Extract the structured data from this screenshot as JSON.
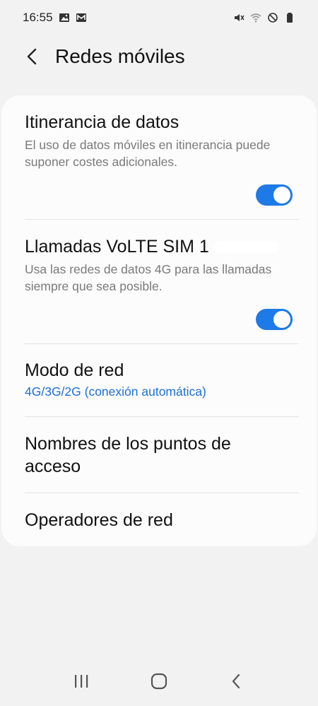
{
  "status_bar": {
    "time": "16:55",
    "icons_left": [
      "gallery-icon",
      "mail-icon"
    ],
    "icons_right": [
      "mute-icon",
      "wifi-icon",
      "do-not-disturb-icon",
      "battery-icon"
    ]
  },
  "header": {
    "title": "Redes móviles",
    "back_icon": "back-arrow-icon"
  },
  "items": [
    {
      "title": "Itinerancia de datos",
      "description": "El uso de datos móviles en itinerancia puede suponer costes adicionales.",
      "toggle_on": true
    },
    {
      "title": "Llamadas VoLTE SIM 1",
      "description": "Usa las redes de datos 4G para las llamadas siempre que sea posible.",
      "toggle_on": true
    },
    {
      "title": "Modo de red",
      "subtitle": "4G/3G/2G (conexión automática)"
    },
    {
      "title": "Nombres de los puntos de acceso"
    },
    {
      "title": "Operadores de red"
    }
  ],
  "colors": {
    "accent": "#1e7ae6",
    "subtitle_link": "#1d6fd6",
    "background": "#f2f2f2",
    "card": "#fcfcfc"
  },
  "nav_bar": {
    "buttons": [
      "recent-apps-icon",
      "home-icon",
      "back-icon"
    ]
  }
}
